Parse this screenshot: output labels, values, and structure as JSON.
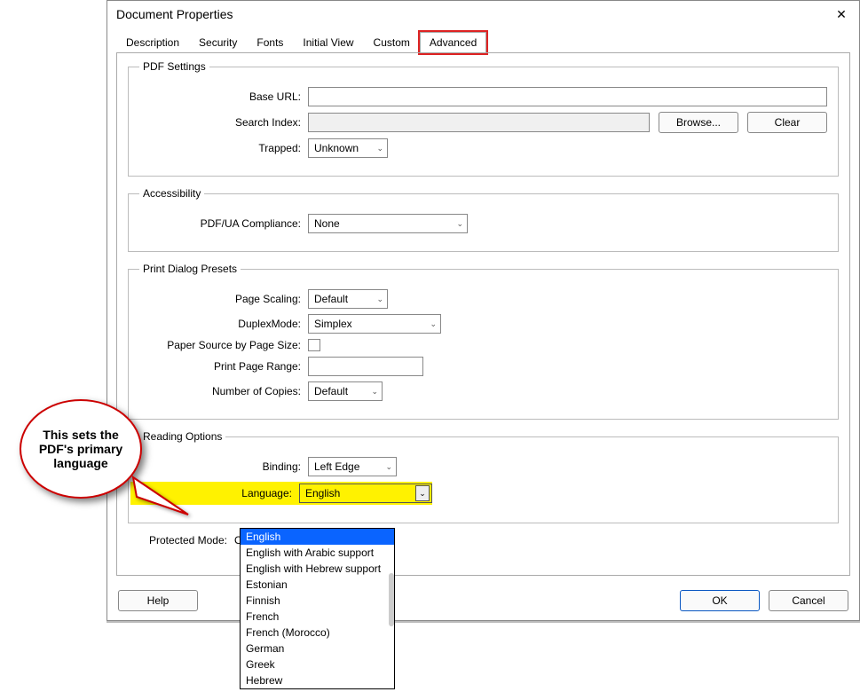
{
  "window": {
    "title": "Document Properties"
  },
  "tabs": {
    "items": [
      "Description",
      "Security",
      "Fonts",
      "Initial View",
      "Custom",
      "Advanced"
    ],
    "active": 5
  },
  "pdf_settings": {
    "legend": "PDF Settings",
    "base_url_label": "Base URL:",
    "base_url_value": "",
    "search_index_label": "Search Index:",
    "search_index_value": "",
    "browse_label": "Browse...",
    "clear_label": "Clear",
    "trapped_label": "Trapped:",
    "trapped_value": "Unknown"
  },
  "accessibility": {
    "legend": "Accessibility",
    "compliance_label": "PDF/UA Compliance:",
    "compliance_value": "None"
  },
  "print_presets": {
    "legend": "Print Dialog Presets",
    "page_scaling_label": "Page Scaling:",
    "page_scaling_value": "Default",
    "duplex_label": "DuplexMode:",
    "duplex_value": "Simplex",
    "paper_source_label": "Paper Source by Page Size:",
    "paper_source_checked": false,
    "print_range_label": "Print Page Range:",
    "print_range_value": "",
    "copies_label": "Number of Copies:",
    "copies_value": "Default"
  },
  "reading_options": {
    "legend": "Reading Options",
    "binding_label": "Binding:",
    "binding_value": "Left Edge",
    "language_label": "Language:",
    "language_value": "English",
    "language_options": [
      "English",
      "English with Arabic support",
      "English with Hebrew support",
      "Estonian",
      "Finnish",
      "French",
      "French (Morocco)",
      "German",
      "Greek",
      "Hebrew"
    ],
    "language_selected_index": 0
  },
  "protected_mode": {
    "label": "Protected Mode:",
    "value": "On"
  },
  "footer": {
    "help": "Help",
    "ok": "OK",
    "cancel": "Cancel"
  },
  "callout": {
    "text": "This sets the PDF's primary language"
  }
}
